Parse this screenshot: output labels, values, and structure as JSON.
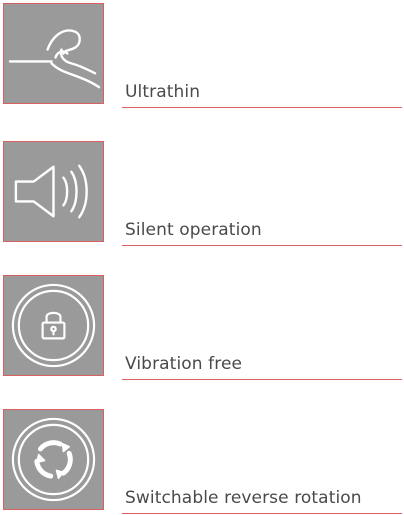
{
  "colors": {
    "tile_background": "#9a9a9a",
    "accent": "#d8605e",
    "label_text": "#4a4a4a",
    "icon_stroke": "#ffffff"
  },
  "features": [
    {
      "label": "Ultrathin",
      "icon": "hand-pinch-icon"
    },
    {
      "label": "Silent operation",
      "icon": "speaker-icon"
    },
    {
      "label": "Vibration free",
      "icon": "padlock-icon"
    },
    {
      "label": "Switchable reverse rotation",
      "icon": "reverse-rotation-icon"
    }
  ]
}
